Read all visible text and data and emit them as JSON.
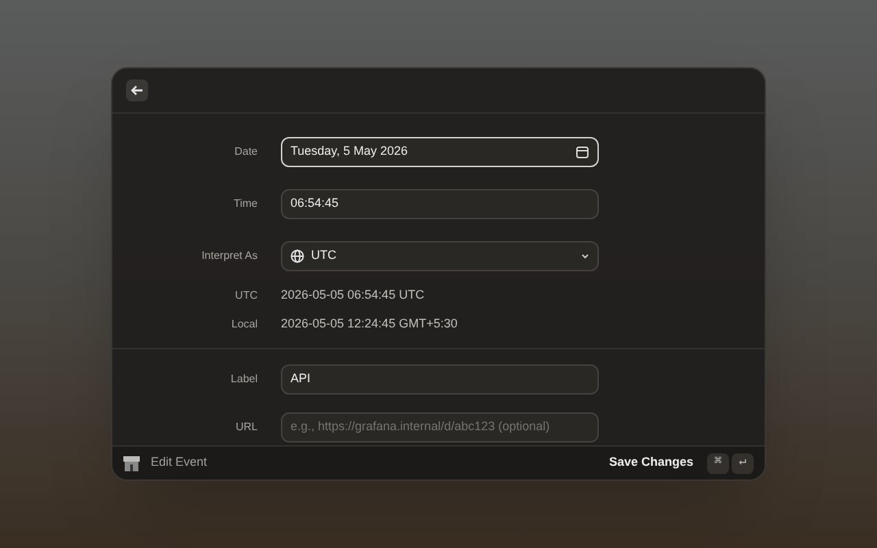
{
  "form": [
    {
      "kind": "date",
      "label": "Date",
      "value": "Tuesday, 5 May 2026",
      "focused": true
    },
    {
      "kind": "text",
      "label": "Time",
      "value": "06:54:45",
      "focused": false
    },
    {
      "kind": "select",
      "label": "Interpret As",
      "value": "UTC",
      "focused": false
    }
  ],
  "readouts": [
    {
      "label": "UTC",
      "value": "2026-05-05 06:54:45 UTC"
    },
    {
      "label": "Local",
      "value": "2026-05-05 12:24:45 GMT+5:30"
    }
  ],
  "details": [
    {
      "kind": "text",
      "label": "Label",
      "value": "API",
      "focused": false
    },
    {
      "kind": "text",
      "label": "URL",
      "placeholder": "e.g., https://grafana.internal/d/abc123 (optional)",
      "focused": false
    }
  ],
  "footer": {
    "title": "Edit Event",
    "action": "Save Changes",
    "keys": [
      "⌘",
      "↵"
    ]
  }
}
